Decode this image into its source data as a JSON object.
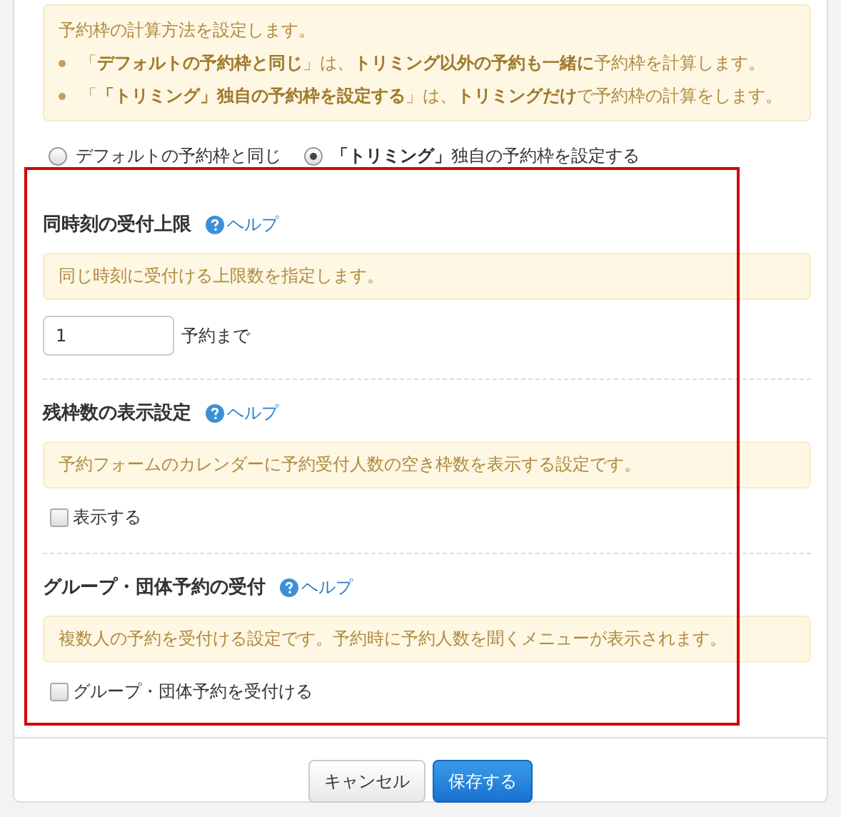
{
  "intro": {
    "text": "予約枠の計算方法を設定します。",
    "bullets": [
      "「**デフォルトの予約枠と同じ**」は、**トリミング以外の予約も一緒に**予約枠を計算します。",
      "「**「トリミング」独自の予約枠を設定する**」は、**トリミングだけ**で予約枠の計算をします。"
    ]
  },
  "mode_options": [
    {
      "label": "デフォルトの予約枠と同じ",
      "selected": false
    },
    {
      "label": "**「トリミング」**独自の予約枠を設定する",
      "selected": true
    }
  ],
  "sections": [
    {
      "kind": "input",
      "title": "同時刻の受付上限",
      "help": "ヘルプ",
      "note": "同じ時刻に受付ける上限数を指定します。",
      "value": "1",
      "suffix": "予約まで"
    },
    {
      "kind": "checkbox",
      "title": "残枠数の表示設定",
      "help": "ヘルプ",
      "note": "予約フォームのカレンダーに予約受付人数の空き枠数を表示する設定です。",
      "label": "表示する",
      "checked": false
    },
    {
      "kind": "checkbox",
      "title": "グループ・団体予約の受付",
      "help": "ヘルプ",
      "note": "複数人の予約を受付ける設定です。予約時に予約人数を聞くメニューが表示されます。",
      "label": "グループ・団体予約を受付ける",
      "checked": false
    }
  ],
  "buttons": [
    {
      "label": "キャンセル",
      "kind": "default"
    },
    {
      "label": "保存する",
      "kind": "primary"
    }
  ]
}
